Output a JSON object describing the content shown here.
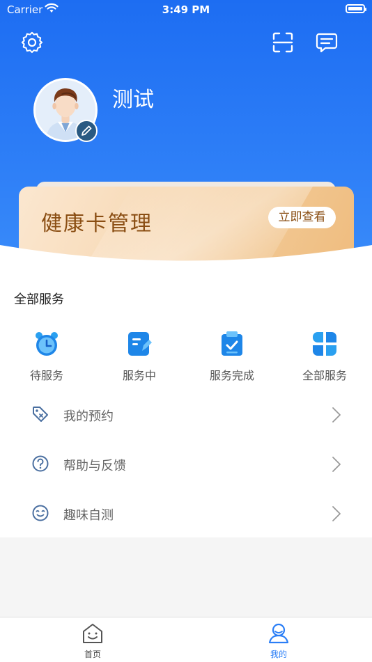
{
  "status_bar": {
    "carrier": "Carrier",
    "time": "3:49 PM"
  },
  "header": {
    "icons": [
      "settings-icon",
      "scan-icon",
      "message-icon"
    ],
    "username": "测试",
    "background_color": "#2e7ff7"
  },
  "health_card": {
    "title": "健康卡管理",
    "button_label": "立即查看"
  },
  "services": {
    "title": "全部服务",
    "items": [
      {
        "label": "待服务",
        "icon": "alarm-clock-icon"
      },
      {
        "label": "服务中",
        "icon": "document-edit-icon"
      },
      {
        "label": "服务完成",
        "icon": "clipboard-check-icon"
      },
      {
        "label": "全部服务",
        "icon": "grid-icon"
      }
    ]
  },
  "menu": [
    {
      "label": "我的预约",
      "icon": "tag-icon"
    },
    {
      "label": "帮助与反馈",
      "icon": "help-icon"
    },
    {
      "label": "趣味自测",
      "icon": "smile-icon"
    }
  ],
  "tabbar": {
    "tabs": [
      {
        "label": "首页",
        "icon": "home-icon",
        "active": false
      },
      {
        "label": "我的",
        "icon": "profile-icon",
        "active": true
      }
    ],
    "active_color": "#2a7ef6"
  }
}
